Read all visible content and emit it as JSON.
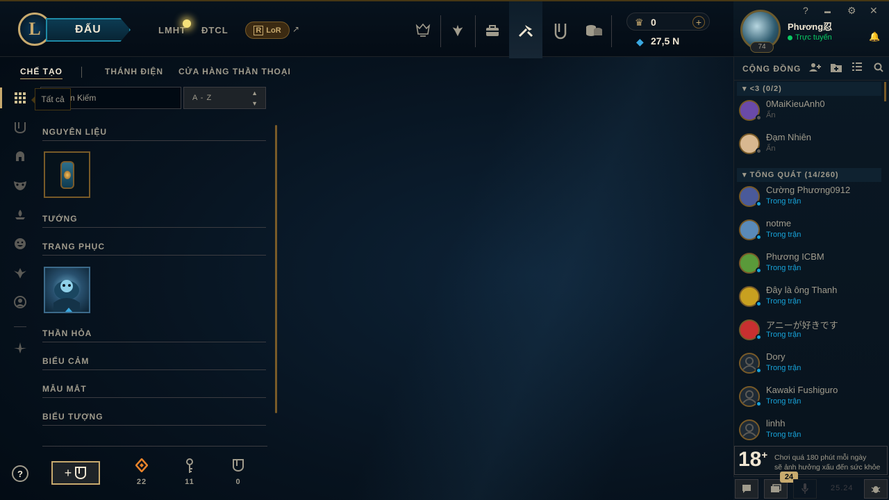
{
  "topbar": {
    "logo": "L",
    "play_label": "ĐẤU",
    "nav": [
      "LMHT",
      "ĐTCL"
    ],
    "lor_label": "LoR",
    "lor_icon": "R",
    "ext_icon": "↗",
    "icons": [
      "worlds-icon",
      "tft-icon",
      "store-icon",
      "loot-icon",
      "collection-icon",
      "coins-icon"
    ],
    "currency": {
      "be": "0",
      "rp": "27,5 N"
    }
  },
  "profile": {
    "name": "Phương忍",
    "status": "Trực tuyến",
    "level": "74"
  },
  "window": {
    "help": "?",
    "minimize": "▬",
    "settings": "⚙",
    "close": "✕"
  },
  "tabs": [
    {
      "label": "CHẾ TẠO"
    },
    {
      "label": "THÁNH ĐIỆN"
    },
    {
      "label": "CỬA HÀNG THẦN THOẠI"
    }
  ],
  "tooltip": "Tất cả",
  "search": {
    "placeholder": "Tìm Kiếm",
    "visible": "n Kiếm"
  },
  "sort": {
    "value": "A - Z"
  },
  "categories": [
    "NGUYÊN LIỆU",
    "TƯỚNG",
    "TRANG PHỤC",
    "THẦN HỎA",
    "BIỂU CẢM",
    "MẪU MẮT",
    "BIỂU TƯỢNG"
  ],
  "wallet": [
    {
      "icon": "orange-essence-icon",
      "value": "22"
    },
    {
      "icon": "key-icon",
      "value": "11"
    },
    {
      "icon": "chest-icon",
      "value": "0"
    }
  ],
  "social": {
    "title": "CỘNG ĐỒNG",
    "groups": [
      {
        "label": "<3 (0/2)"
      },
      {
        "label": "TỔNG QUÁT (14/260)"
      }
    ],
    "friends": [
      {
        "name": "0MaiKieuAnh0",
        "status": "Ẩn",
        "color": "#6a4aa8"
      },
      {
        "name": "Đạm Nhiên",
        "status": "Ẩn",
        "color": "#d8b890"
      },
      {
        "name": "Cường Phương0912",
        "status": "Trong trận",
        "color": "#4a5a9a"
      },
      {
        "name": "notme",
        "status": "Trong trận",
        "color": "#5a8ab8"
      },
      {
        "name": "Phương ICBM",
        "status": "Trong trận",
        "color": "#5a9a3a"
      },
      {
        "name": "Đây là ông Thanh",
        "status": "Trong trận",
        "color": "#c8a020"
      },
      {
        "name": "アニーが好きです",
        "status": "Trong trận",
        "color": "#c83030"
      },
      {
        "name": "Dory",
        "status": "Trong trận",
        "color": "#2a3a4a"
      },
      {
        "name": "Kawaki Fushiguro",
        "status": "Trong trận",
        "color": "#2a3a4a"
      },
      {
        "name": "linhh",
        "status": "Trong trận",
        "color": "#2a3a4a"
      }
    ]
  },
  "warning": {
    "age": "18",
    "line1": "Chơi quá 180 phút mỗi ngày",
    "line2": "sẽ ảnh hưởng xấu đến sức khỏe"
  },
  "footer": {
    "badge": "24",
    "version": "25.24"
  }
}
